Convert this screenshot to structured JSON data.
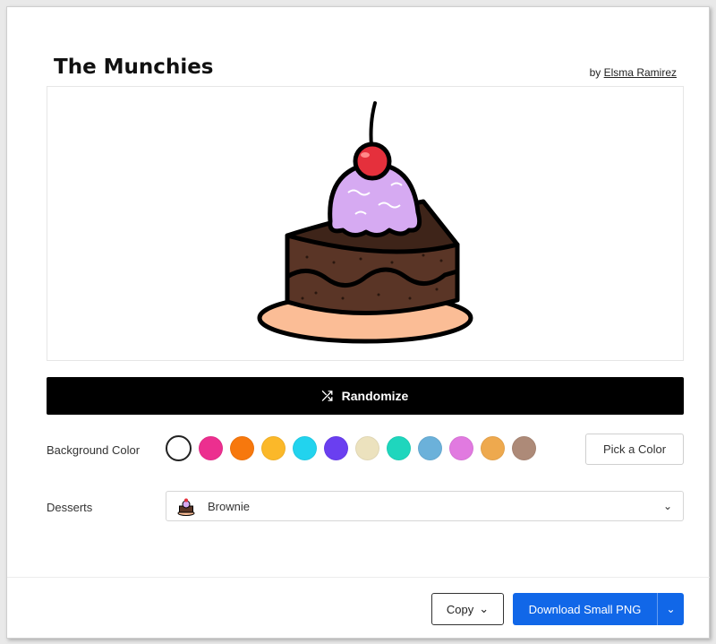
{
  "header": {
    "title": "The Munchies",
    "by_prefix": "by",
    "author": "Elsma Ramirez"
  },
  "preview": {
    "illustration": "cake-slice-with-ice-cream-and-cherry"
  },
  "randomize": {
    "label": "Randomize",
    "icon": "shuffle-icon"
  },
  "background_color": {
    "label": "Background Color",
    "swatches": [
      "#ffffff",
      "#ec2f8f",
      "#f7780d",
      "#fbb829",
      "#22d3ee",
      "#6a3ff0",
      "#ece2be",
      "#1fd6bd",
      "#6bb1da",
      "#e17ae0",
      "#eea94e",
      "#ad8a78"
    ],
    "selected_index": 0,
    "pick_label": "Pick a Color"
  },
  "desserts": {
    "label": "Desserts",
    "selected": "Brownie",
    "thumb_icon": "cake-thumbnail-icon"
  },
  "footer": {
    "copy_label": "Copy",
    "download_label": "Download Small PNG"
  },
  "colors": {
    "primary": "#1167e8",
    "cake": "#5a3526",
    "ice_cream": "#d6aaf2",
    "plate": "#fbbd96",
    "cherry": "#e5303c"
  }
}
